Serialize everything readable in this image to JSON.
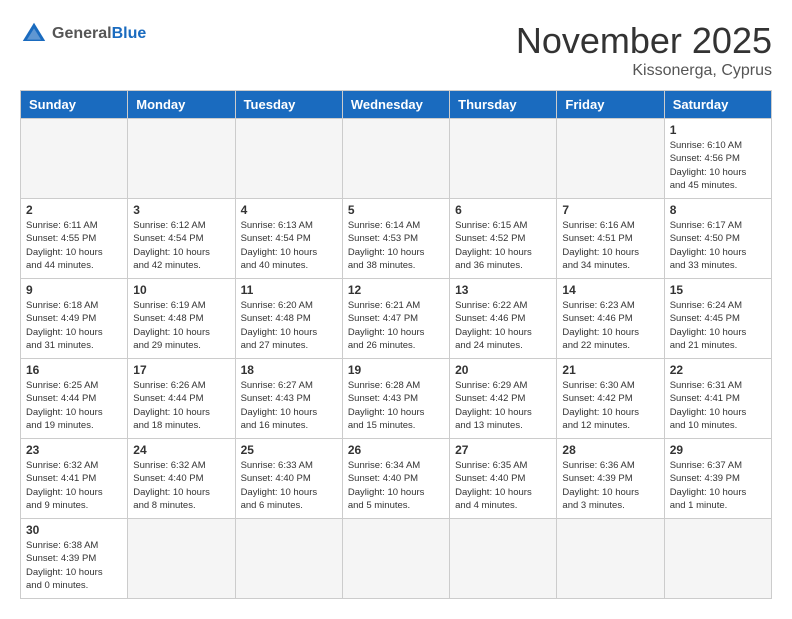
{
  "header": {
    "logo_general": "General",
    "logo_blue": "Blue",
    "month_title": "November 2025",
    "location": "Kissonerga, Cyprus"
  },
  "weekdays": [
    "Sunday",
    "Monday",
    "Tuesday",
    "Wednesday",
    "Thursday",
    "Friday",
    "Saturday"
  ],
  "weeks": [
    [
      {
        "day": "",
        "content": ""
      },
      {
        "day": "",
        "content": ""
      },
      {
        "day": "",
        "content": ""
      },
      {
        "day": "",
        "content": ""
      },
      {
        "day": "",
        "content": ""
      },
      {
        "day": "",
        "content": ""
      },
      {
        "day": "1",
        "content": "Sunrise: 6:10 AM\nSunset: 4:56 PM\nDaylight: 10 hours\nand 45 minutes."
      }
    ],
    [
      {
        "day": "2",
        "content": "Sunrise: 6:11 AM\nSunset: 4:55 PM\nDaylight: 10 hours\nand 44 minutes."
      },
      {
        "day": "3",
        "content": "Sunrise: 6:12 AM\nSunset: 4:54 PM\nDaylight: 10 hours\nand 42 minutes."
      },
      {
        "day": "4",
        "content": "Sunrise: 6:13 AM\nSunset: 4:54 PM\nDaylight: 10 hours\nand 40 minutes."
      },
      {
        "day": "5",
        "content": "Sunrise: 6:14 AM\nSunset: 4:53 PM\nDaylight: 10 hours\nand 38 minutes."
      },
      {
        "day": "6",
        "content": "Sunrise: 6:15 AM\nSunset: 4:52 PM\nDaylight: 10 hours\nand 36 minutes."
      },
      {
        "day": "7",
        "content": "Sunrise: 6:16 AM\nSunset: 4:51 PM\nDaylight: 10 hours\nand 34 minutes."
      },
      {
        "day": "8",
        "content": "Sunrise: 6:17 AM\nSunset: 4:50 PM\nDaylight: 10 hours\nand 33 minutes."
      }
    ],
    [
      {
        "day": "9",
        "content": "Sunrise: 6:18 AM\nSunset: 4:49 PM\nDaylight: 10 hours\nand 31 minutes."
      },
      {
        "day": "10",
        "content": "Sunrise: 6:19 AM\nSunset: 4:48 PM\nDaylight: 10 hours\nand 29 minutes."
      },
      {
        "day": "11",
        "content": "Sunrise: 6:20 AM\nSunset: 4:48 PM\nDaylight: 10 hours\nand 27 minutes."
      },
      {
        "day": "12",
        "content": "Sunrise: 6:21 AM\nSunset: 4:47 PM\nDaylight: 10 hours\nand 26 minutes."
      },
      {
        "day": "13",
        "content": "Sunrise: 6:22 AM\nSunset: 4:46 PM\nDaylight: 10 hours\nand 24 minutes."
      },
      {
        "day": "14",
        "content": "Sunrise: 6:23 AM\nSunset: 4:46 PM\nDaylight: 10 hours\nand 22 minutes."
      },
      {
        "day": "15",
        "content": "Sunrise: 6:24 AM\nSunset: 4:45 PM\nDaylight: 10 hours\nand 21 minutes."
      }
    ],
    [
      {
        "day": "16",
        "content": "Sunrise: 6:25 AM\nSunset: 4:44 PM\nDaylight: 10 hours\nand 19 minutes."
      },
      {
        "day": "17",
        "content": "Sunrise: 6:26 AM\nSunset: 4:44 PM\nDaylight: 10 hours\nand 18 minutes."
      },
      {
        "day": "18",
        "content": "Sunrise: 6:27 AM\nSunset: 4:43 PM\nDaylight: 10 hours\nand 16 minutes."
      },
      {
        "day": "19",
        "content": "Sunrise: 6:28 AM\nSunset: 4:43 PM\nDaylight: 10 hours\nand 15 minutes."
      },
      {
        "day": "20",
        "content": "Sunrise: 6:29 AM\nSunset: 4:42 PM\nDaylight: 10 hours\nand 13 minutes."
      },
      {
        "day": "21",
        "content": "Sunrise: 6:30 AM\nSunset: 4:42 PM\nDaylight: 10 hours\nand 12 minutes."
      },
      {
        "day": "22",
        "content": "Sunrise: 6:31 AM\nSunset: 4:41 PM\nDaylight: 10 hours\nand 10 minutes."
      }
    ],
    [
      {
        "day": "23",
        "content": "Sunrise: 6:32 AM\nSunset: 4:41 PM\nDaylight: 10 hours\nand 9 minutes."
      },
      {
        "day": "24",
        "content": "Sunrise: 6:32 AM\nSunset: 4:40 PM\nDaylight: 10 hours\nand 8 minutes."
      },
      {
        "day": "25",
        "content": "Sunrise: 6:33 AM\nSunset: 4:40 PM\nDaylight: 10 hours\nand 6 minutes."
      },
      {
        "day": "26",
        "content": "Sunrise: 6:34 AM\nSunset: 4:40 PM\nDaylight: 10 hours\nand 5 minutes."
      },
      {
        "day": "27",
        "content": "Sunrise: 6:35 AM\nSunset: 4:40 PM\nDaylight: 10 hours\nand 4 minutes."
      },
      {
        "day": "28",
        "content": "Sunrise: 6:36 AM\nSunset: 4:39 PM\nDaylight: 10 hours\nand 3 minutes."
      },
      {
        "day": "29",
        "content": "Sunrise: 6:37 AM\nSunset: 4:39 PM\nDaylight: 10 hours\nand 1 minute."
      }
    ],
    [
      {
        "day": "30",
        "content": "Sunrise: 6:38 AM\nSunset: 4:39 PM\nDaylight: 10 hours\nand 0 minutes."
      },
      {
        "day": "",
        "content": ""
      },
      {
        "day": "",
        "content": ""
      },
      {
        "day": "",
        "content": ""
      },
      {
        "day": "",
        "content": ""
      },
      {
        "day": "",
        "content": ""
      },
      {
        "day": "",
        "content": ""
      }
    ]
  ]
}
